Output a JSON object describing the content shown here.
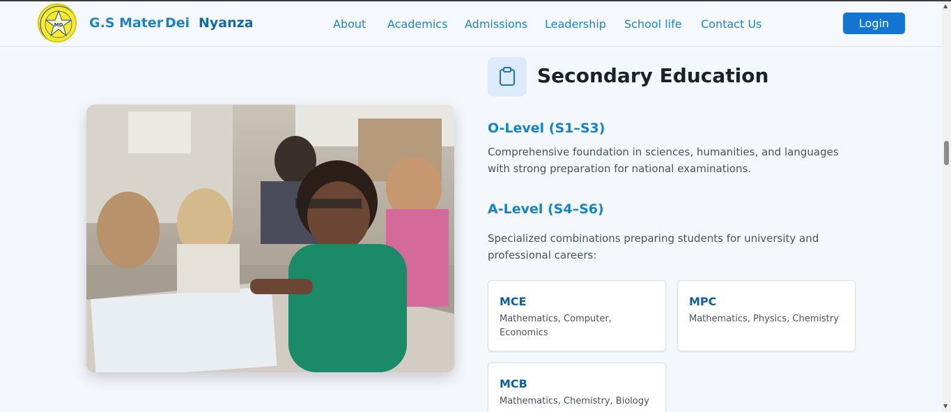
{
  "header": {
    "brand": [
      "G.S Mater",
      "Dei",
      "Nyanza"
    ],
    "nav": [
      "About",
      "Academics",
      "Admissions",
      "Leadership",
      "School life",
      "Contact Us"
    ],
    "login_label": "Login",
    "logo_icon": "school-crest-icon"
  },
  "section": {
    "title": "Secondary Education",
    "icon": "clipboard-icon",
    "olevel": {
      "title": "O-Level (S1–S3)",
      "text": "Comprehensive foundation in sciences, humanities, and languages with strong preparation for national examinations."
    },
    "alevel": {
      "title": "A-Level (S4–S6)",
      "text": "Specialized combinations preparing students for university and professional careers:"
    },
    "combinations": [
      {
        "code": "MCE",
        "subjects": "Mathematics, Computer, Economics"
      },
      {
        "code": "MPC",
        "subjects": "Mathematics, Physics, Chemistry"
      },
      {
        "code": "MCB",
        "subjects": "Mathematics, Chemistry, Biology"
      }
    ]
  },
  "colors": {
    "accent": "#1683c7",
    "button": "#1476d2",
    "background": "#f4f8fd"
  }
}
